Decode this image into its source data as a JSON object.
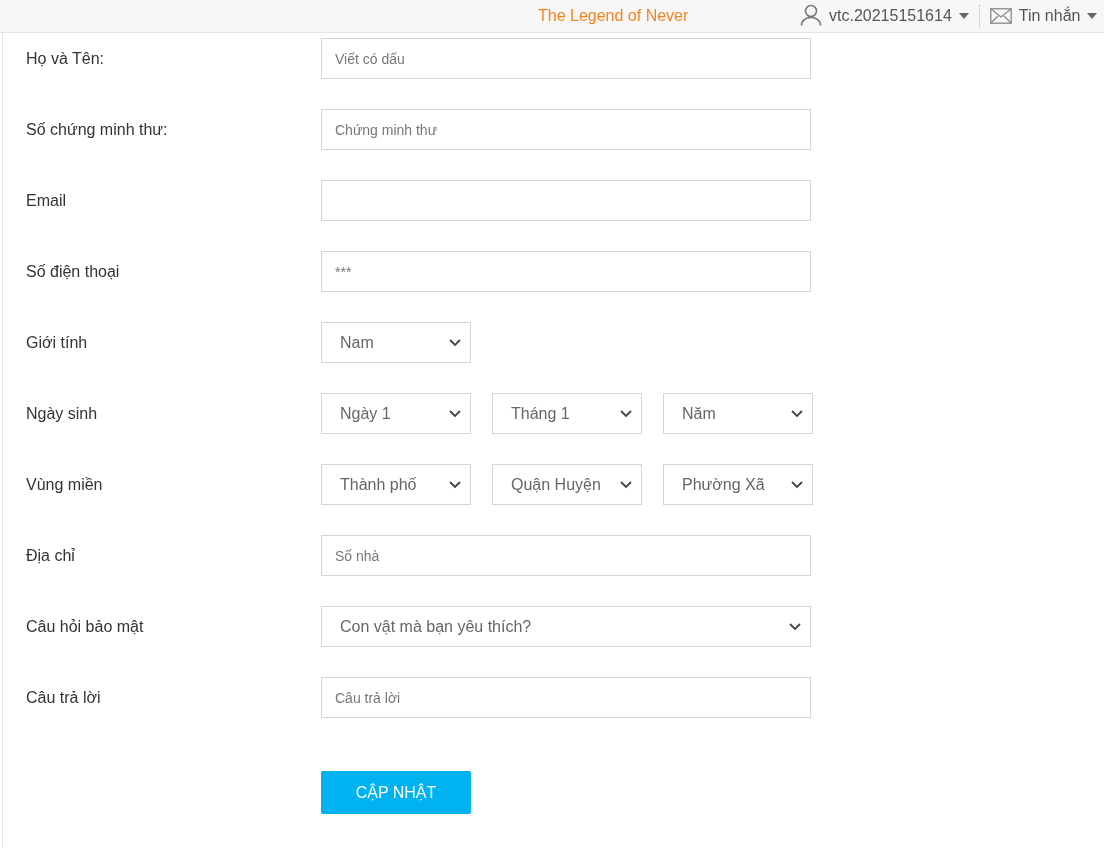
{
  "top_bar": {
    "title": "The Legend of Never",
    "username": "vtc.20215151614",
    "messages": "Tin nhắn"
  },
  "form": {
    "rows": [
      {
        "label": "Họ và Tên:",
        "kind": "text",
        "placeholder": "Viết có dấu"
      },
      {
        "label": "Số chứng minh thư:",
        "kind": "text",
        "placeholder": "Chứng minh thư"
      },
      {
        "label": "Email",
        "kind": "text"
      },
      {
        "label": "Số điện thoại",
        "kind": "text",
        "placeholder": "***"
      },
      {
        "label": "Giới tính",
        "kind": "select",
        "selects": [
          {
            "value": "Nam"
          }
        ]
      },
      {
        "label": "Ngày sinh",
        "kind": "select",
        "selects": [
          {
            "value": "Ngày 1"
          },
          {
            "value": "Tháng 1"
          },
          {
            "value": "Năm"
          }
        ]
      },
      {
        "label": "Vùng miền",
        "kind": "select",
        "selects": [
          {
            "value": "Thành phố"
          },
          {
            "value": "Quận Huyện"
          },
          {
            "value": "Phường Xã"
          }
        ]
      },
      {
        "label": "Địa chỉ",
        "kind": "text",
        "placeholder": "Số nhà"
      },
      {
        "label": "Câu hỏi bảo mật",
        "kind": "wide-select",
        "selects": [
          {
            "value": "Con vật mà bạn yêu thích?"
          }
        ]
      },
      {
        "label": "Câu trả lời",
        "kind": "text",
        "placeholder": "Câu trả lời"
      }
    ],
    "submit": "CẬP NHẬT"
  }
}
